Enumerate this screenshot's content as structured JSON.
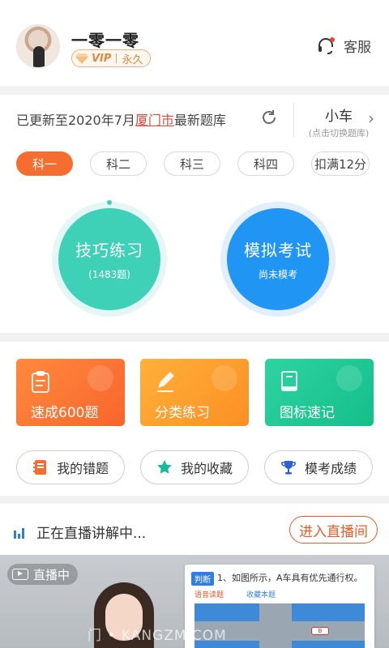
{
  "user": {
    "name": "一零一零",
    "vip_label": "VIP",
    "vip_duration": "永久"
  },
  "header": {
    "service_label": "客服"
  },
  "bank": {
    "update_prefix": "已更新至2020年7月",
    "city": "厦门市",
    "update_suffix": "最新题库",
    "vehicle": "小车",
    "vehicle_hint": "(点击切换题库)"
  },
  "subjects": [
    {
      "label": "科一",
      "active": true
    },
    {
      "label": "科二",
      "active": false
    },
    {
      "label": "科三",
      "active": false
    },
    {
      "label": "科四",
      "active": false
    },
    {
      "label": "扣满12分",
      "active": false
    }
  ],
  "practice": {
    "title": "技巧练习",
    "count": "(1483题)"
  },
  "exam": {
    "title": "模拟考试",
    "status": "尚未模考"
  },
  "tiles": [
    {
      "label": "速成600题"
    },
    {
      "label": "分类练习"
    },
    {
      "label": "图标速记"
    }
  ],
  "pills": [
    {
      "label": "我的错题"
    },
    {
      "label": "我的收藏"
    },
    {
      "label": "模考成绩"
    }
  ],
  "live": {
    "status_text": "正在直播讲解中...",
    "enter_button": "进入直播间",
    "badge": "直播中",
    "slide_tag": "判断",
    "slide_question": "1、如图所示，A车具有优先通行权。",
    "slide_option1": "语音读题",
    "slide_option2": "收藏本题",
    "watermark": "门 • KANGZM.COM"
  },
  "colors": {
    "primary_orange": "#f56e2f",
    "teal": "#3ed1b8",
    "blue": "#2195f3",
    "city_red": "#e24b3b"
  }
}
